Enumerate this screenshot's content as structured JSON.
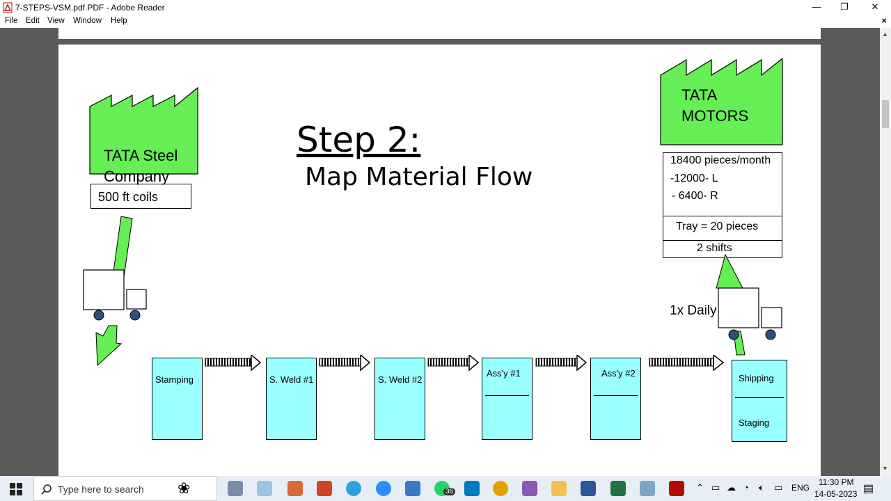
{
  "window": {
    "title": "7-STEPS-VSM.pdf.PDF - Adobe Reader",
    "minimize": "—",
    "maximize": "❐",
    "close": "✕"
  },
  "menu": [
    "File",
    "Edit",
    "View",
    "Window",
    "Help"
  ],
  "document": {
    "heading": "Step 2:",
    "subheading": "Map Material Flow",
    "supplier": {
      "line1": "TATA Steel",
      "line2": "Company",
      "material": "500 ft coils"
    },
    "customer": {
      "line1": "TATA",
      "line2": "MOTORS",
      "demand": "18400 pieces/month",
      "left": "-12000- L",
      "right": "- 6400- R",
      "tray": "Tray = 20 pieces",
      "shifts": "2 shifts"
    },
    "delivery_frequency": "1x Daily",
    "processes": [
      {
        "label": "Stamping"
      },
      {
        "label": "S. Weld #1"
      },
      {
        "label": "S. Weld #2"
      },
      {
        "label": "Ass'y #1"
      },
      {
        "label": "Ass'y #2"
      },
      {
        "label": "Shipping",
        "sub": "Staging"
      }
    ],
    "colors": {
      "factory": "#66ee55",
      "process": "#99ffff",
      "arrow": "#66ee55"
    }
  },
  "taskbar": {
    "search_placeholder": "Type here to search",
    "language": "ENG",
    "time": "11:30 PM",
    "date": "14-05-2023",
    "whatsapp_badge": "36"
  }
}
